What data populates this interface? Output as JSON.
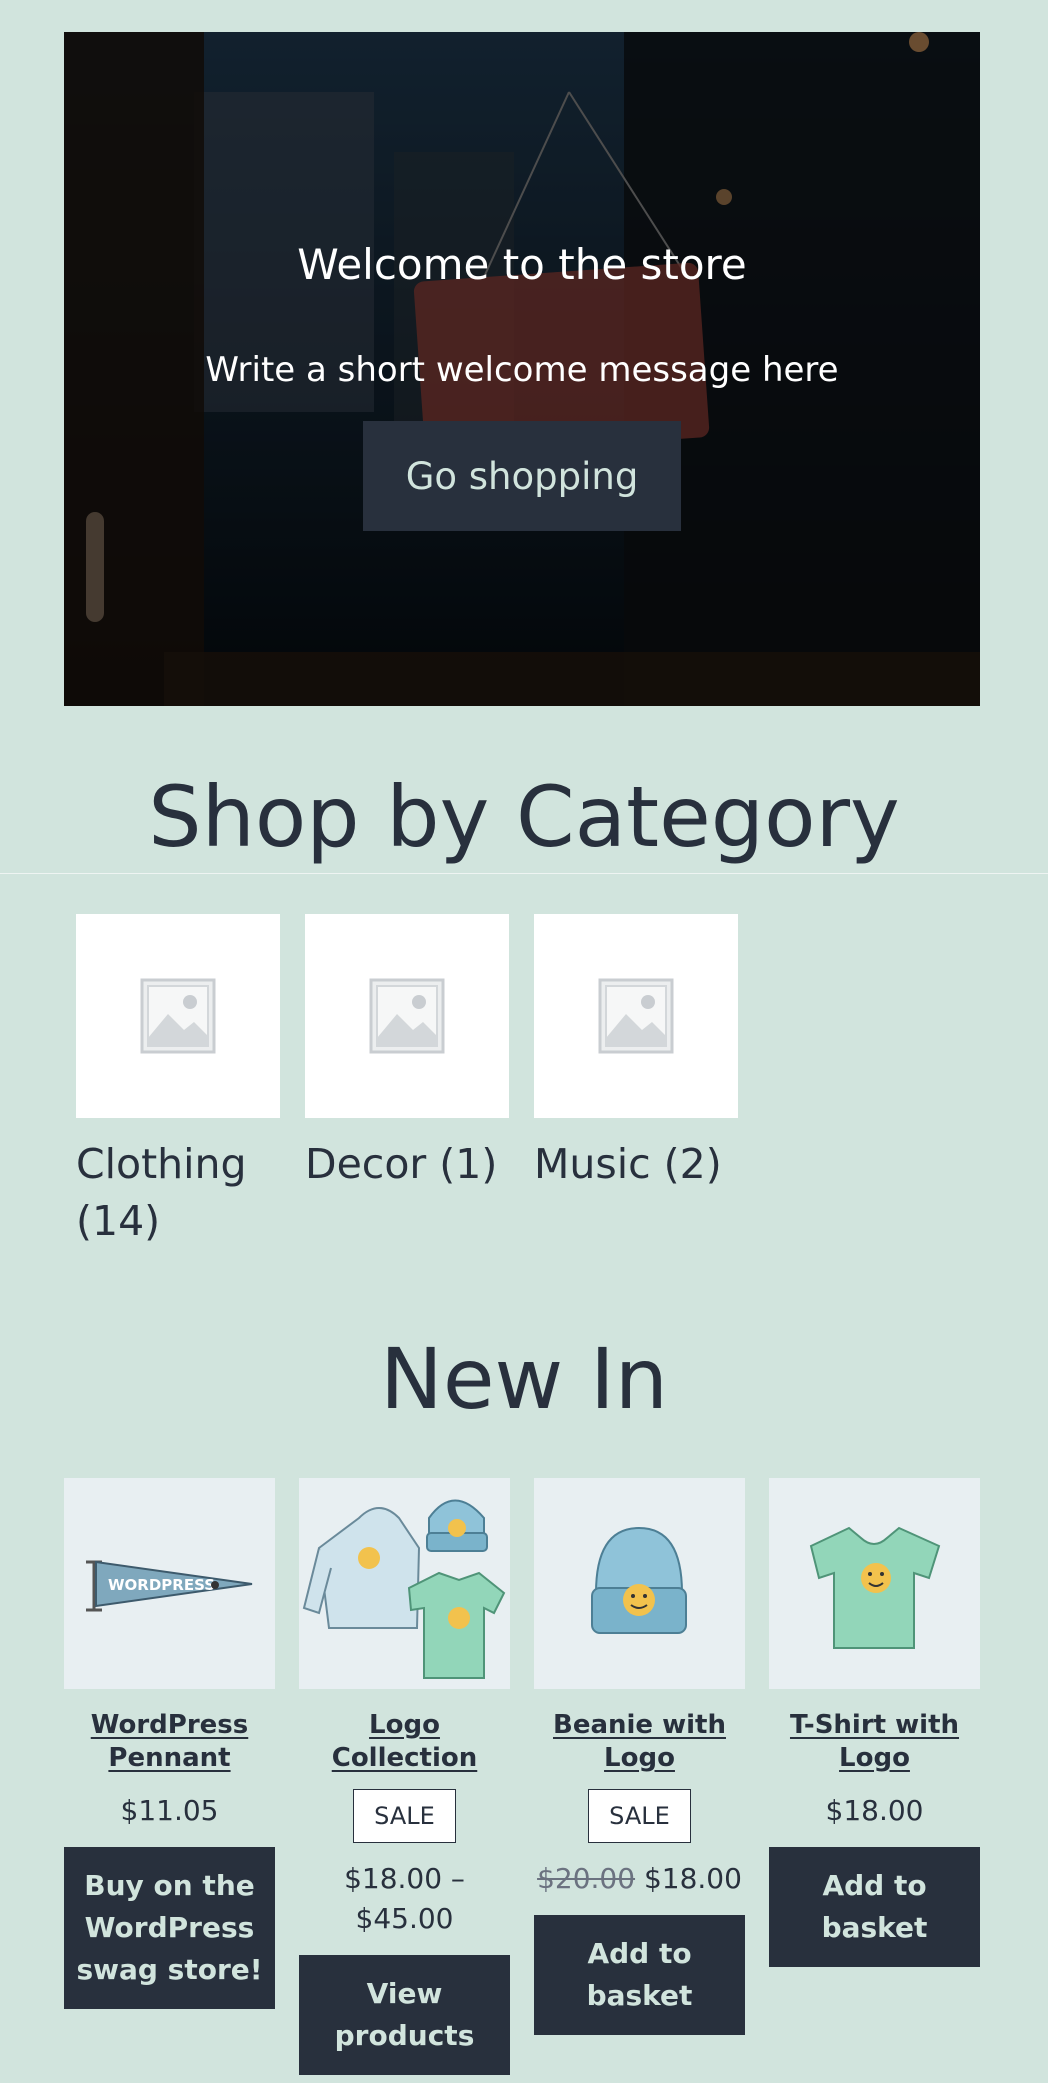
{
  "hero": {
    "title": "Welcome to the store",
    "subtitle": "Write a short welcome message here",
    "button_label": "Go shopping"
  },
  "categories_section": {
    "heading": "Shop by Category",
    "items": [
      {
        "name": "Clothing (14)"
      },
      {
        "name": "Decor (1)"
      },
      {
        "name": "Music (2)"
      }
    ]
  },
  "new_in": {
    "heading": "New In",
    "products": [
      {
        "title": "WordPress Pennant",
        "price": "$11.05",
        "button": "Buy on the WordPress swag store!",
        "image_icon": "pennant-icon"
      },
      {
        "title": "Logo Collection",
        "badge": "SALE",
        "price": "$18.00 – $45.00",
        "button": "View products",
        "image_icon": "clothing-collection-icon"
      },
      {
        "title": "Beanie with Logo",
        "badge": "SALE",
        "old_price": "$20.00",
        "price": "$18.00",
        "button": "Add to basket",
        "image_icon": "beanie-icon"
      },
      {
        "title": "T-Shirt with Logo",
        "price": "$18.00",
        "button": "Add to basket",
        "image_icon": "tshirt-icon"
      }
    ]
  },
  "colors": {
    "background": "#d1e4dd",
    "text": "#28303d",
    "button_bg": "#28303d",
    "button_text": "#d1e4dd"
  }
}
